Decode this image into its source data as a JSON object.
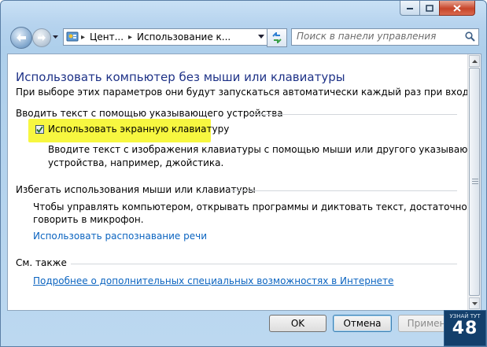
{
  "titlebar": {
    "minimize_icon": "minimize-icon",
    "maximize_icon": "maximize-icon",
    "close_icon": "close-icon"
  },
  "nav": {
    "back_icon": "back-arrow-icon",
    "forward_icon": "forward-arrow-icon",
    "recent_icon": "chevron-down-icon"
  },
  "address": {
    "icon": "control-panel-icon",
    "crumbs": [
      "Цент...",
      "Использование к..."
    ],
    "separator": "▸"
  },
  "refresh_icon": "refresh-icon",
  "search": {
    "placeholder": "Поиск в панели управления",
    "icon": "search-icon"
  },
  "content": {
    "title": "Использовать компьютер без мыши или клавиатуры",
    "subtitle": "При выборе этих параметров они будут запускаться автоматически каждый раз при входе в систему.",
    "section1": {
      "heading": "Вводить текст с помощью указывающего устройства",
      "checkbox_label": "Использовать экранную клавиатуру",
      "checkbox_checked": true,
      "highlight_color": "#f7f740",
      "desc_line1": "Вводите текст с изображения клавиатуры с помощью мыши или другого указывающего",
      "desc_line2": "устройства, например, джойстика."
    },
    "section2": {
      "heading": "Избегать использования мыши или клавиатуры",
      "desc_line1": "Чтобы управлять компьютером, открывать программы и диктовать текст, достаточно просто",
      "desc_line2": "говорить в микрофон.",
      "link": "Использовать распознавание речи"
    },
    "see_also": {
      "heading": "См. также",
      "link": "Подробнее о дополнительных специальных возможностях в Интернете"
    }
  },
  "buttons": {
    "ok": "OK",
    "cancel": "Отмена",
    "apply": "Примен"
  },
  "watermark": {
    "line1": "УЗНАЙ ТУТ",
    "line2": "48"
  },
  "colors": {
    "title": "#1e3287",
    "link": "#0b64c0",
    "frame": "#b6d3ee"
  }
}
